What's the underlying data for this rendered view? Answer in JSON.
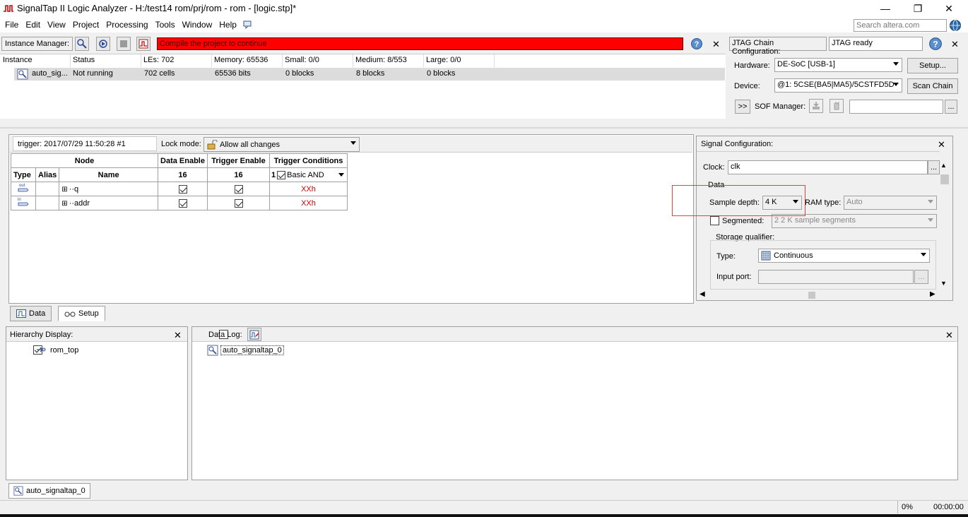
{
  "window": {
    "title": "SignalTap II Logic Analyzer - H:/test14 rom/prj/rom - rom - [logic.stp]*",
    "minimize": "—",
    "maximize": "❐",
    "close": "✕"
  },
  "menu": [
    "File",
    "Edit",
    "View",
    "Project",
    "Processing",
    "Tools",
    "Window",
    "Help"
  ],
  "search": {
    "placeholder": "Search altera.com"
  },
  "instance_manager": {
    "label": "Instance Manager:",
    "status_message": "Compile the project to continue",
    "columns": [
      "Instance",
      "Status",
      "LEs: 702",
      "Memory: 65536",
      "Small: 0/0",
      "Medium: 8/553",
      "Large: 0/0"
    ],
    "row": [
      "auto_sig...",
      "Not running",
      "702 cells",
      "65536 bits",
      "0 blocks",
      "8 blocks",
      "0 blocks"
    ]
  },
  "jtag": {
    "label": "JTAG Chain Configuration:",
    "status": "JTAG ready",
    "hardware_label": "Hardware:",
    "hardware_value": "DE-SoC [USB-1]",
    "setup_button": "Setup...",
    "device_label": "Device:",
    "device_value": "@1: 5CSE(BA5|MA5)/5CSTFD5D",
    "scan_button": "Scan Chain",
    "sof_toggle": ">>",
    "sof_label": "SOF Manager:",
    "sof_browse": "..."
  },
  "setup": {
    "trigger_info": "trigger: 2017/07/29 11:50:28  #1",
    "lock_mode_label": "Lock mode:",
    "lock_mode_value": "Allow all changes",
    "headers": {
      "node": "Node",
      "data_enable": "Data Enable",
      "trigger_enable": "Trigger Enable",
      "trigger_conditions": "Trigger Conditions",
      "type": "Type",
      "alias": "Alias",
      "name": "Name",
      "data_count": "16",
      "trigger_count": "16",
      "cond_index": "1",
      "cond_value": "Basic AND"
    },
    "rows": [
      {
        "type": "out",
        "name": "q",
        "cond": "XXh"
      },
      {
        "type": "in",
        "name": "addr",
        "cond": "XXh"
      }
    ]
  },
  "signal_config": {
    "title": "Signal Configuration:",
    "clock_label": "Clock:",
    "clock_value": "clk",
    "data_group": "Data",
    "sample_depth_label": "Sample depth:",
    "sample_depth_value": "4 K",
    "ram_type_label": "RAM type:",
    "ram_type_value": "Auto",
    "segmented_label": "Segmented:",
    "segmented_value": "2  2 K sample segments",
    "storage_qualifier": "Storage qualifier:",
    "type_label": "Type:",
    "type_value": "Continuous",
    "input_port_label": "Input port:",
    "browse": "..."
  },
  "tabs": {
    "data": "Data",
    "setup": "Setup"
  },
  "hierarchy": {
    "title": "Hierarchy Display:",
    "item": "rom_top"
  },
  "data_log": {
    "title": "Data Log:",
    "item": "auto_signaltap_0"
  },
  "bottom_tab": "auto_signaltap_0",
  "status": {
    "progress": "0%",
    "time": "00:00:00"
  },
  "colors": {
    "error_bar": "#ff0000",
    "highlight_box": "#e84040",
    "cond_text": "#d40000"
  }
}
